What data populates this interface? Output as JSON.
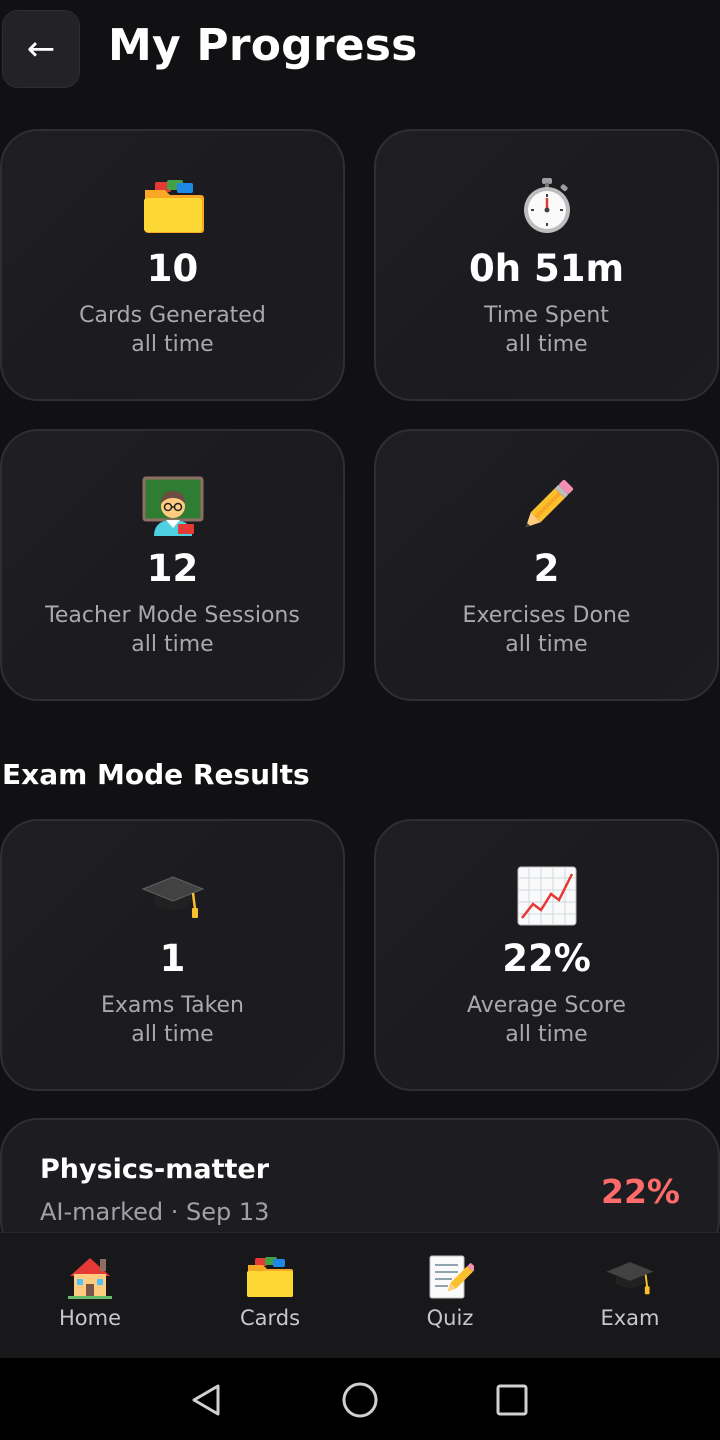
{
  "header": {
    "back_label": "←",
    "title": "My Progress"
  },
  "stats": [
    {
      "icon": "file-folder-icon",
      "value": "10",
      "label": "Cards Generated",
      "sublabel": "all time"
    },
    {
      "icon": "stopwatch-icon",
      "value": "0h 51m",
      "label": "Time Spent",
      "sublabel": "all time"
    },
    {
      "icon": "teacher-icon",
      "value": "12",
      "label": "Teacher Mode Sessions",
      "sublabel": "all time"
    },
    {
      "icon": "pencil-icon",
      "value": "2",
      "label": "Exercises Done",
      "sublabel": "all time"
    }
  ],
  "exam_section": {
    "title": "Exam Mode Results",
    "stats": [
      {
        "icon": "graduation-cap-icon",
        "value": "1",
        "label": "Exams Taken",
        "sublabel": "all time"
      },
      {
        "icon": "chart-increasing-icon",
        "value": "22%",
        "label": "Average Score",
        "sublabel": "all time"
      }
    ],
    "results": [
      {
        "title": "Physics-matter",
        "meta": "AI-marked · Sep 13",
        "score": "22%",
        "score_color": "#ff6b6b"
      }
    ]
  },
  "bottom_nav": [
    {
      "icon": "house-icon",
      "label": "Home"
    },
    {
      "icon": "card-index-dividers-icon",
      "label": "Cards"
    },
    {
      "icon": "memo-icon",
      "label": "Quiz"
    },
    {
      "icon": "graduation-cap-icon",
      "label": "Exam"
    }
  ],
  "colors": {
    "background": "#111114",
    "card": "#1d1d21",
    "score_low": "#ff6b6b",
    "muted_text": "#a8a8ae"
  }
}
